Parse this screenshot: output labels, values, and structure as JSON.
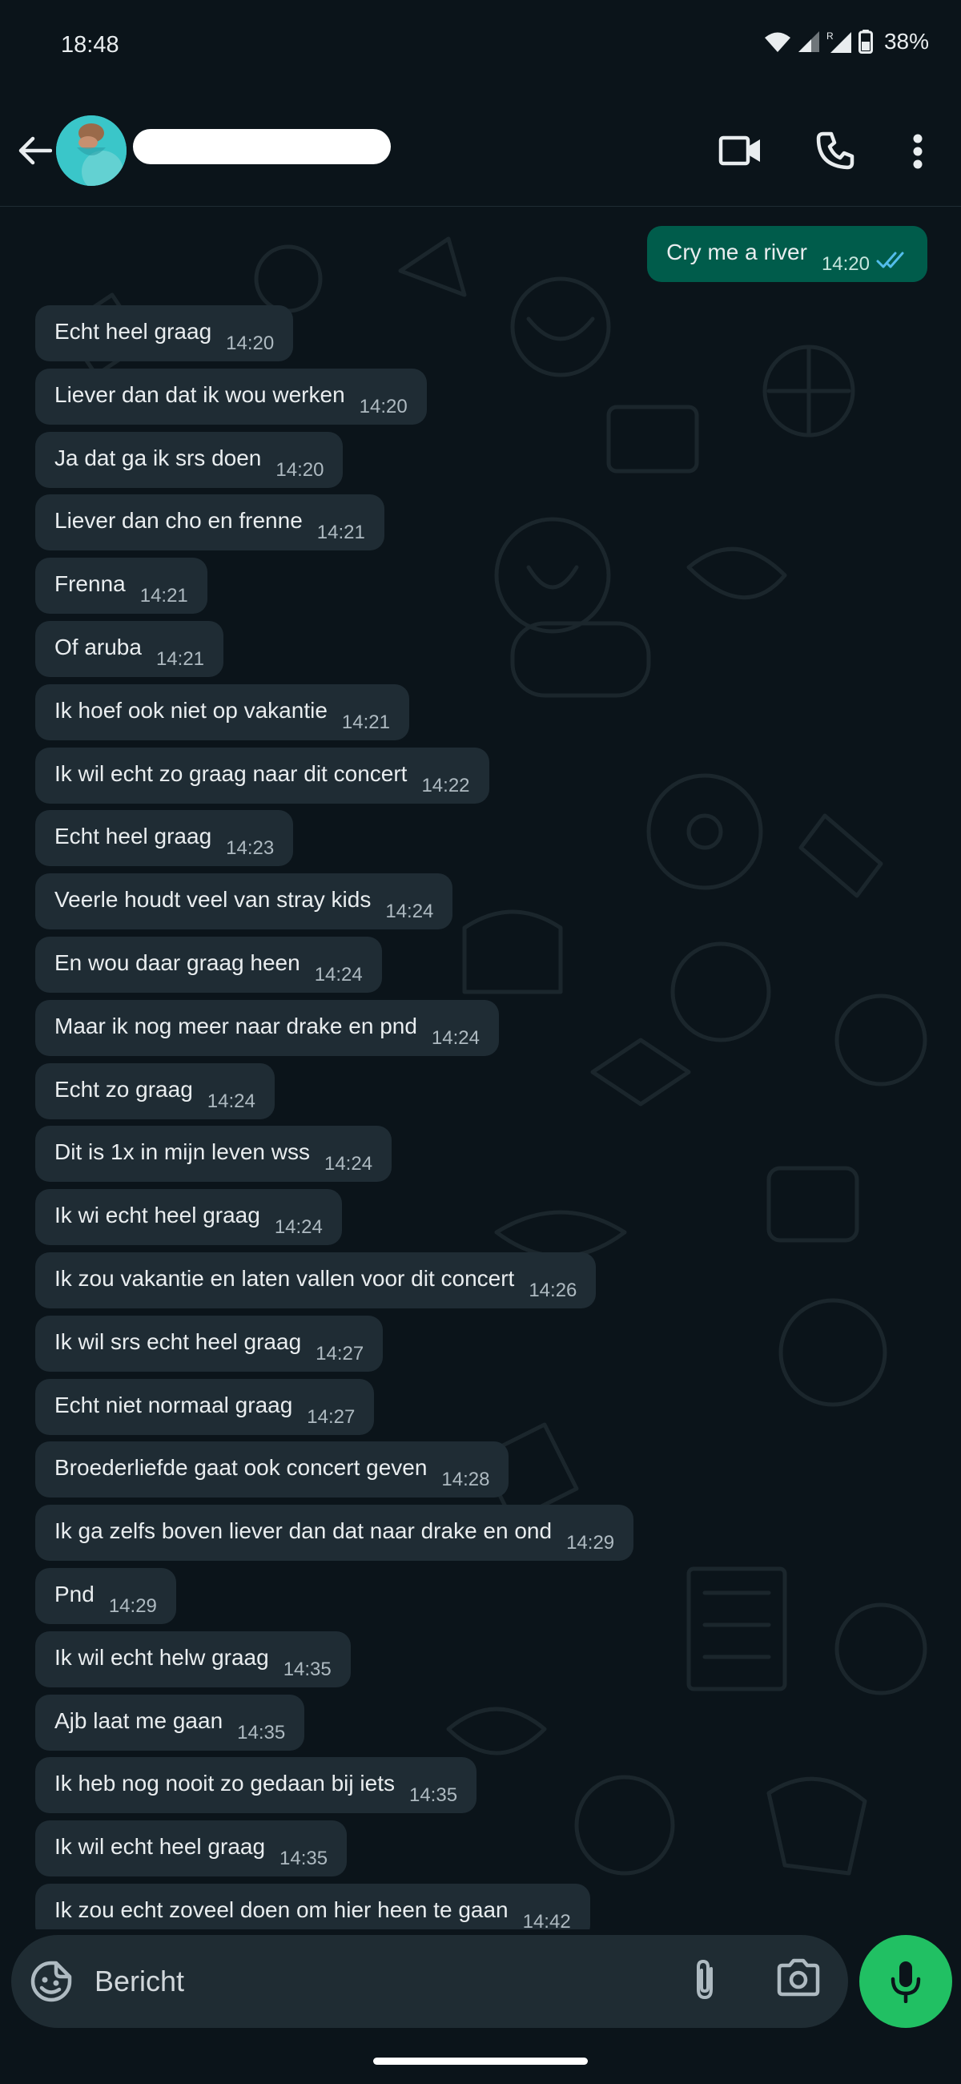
{
  "status_bar": {
    "time": "18:48",
    "battery_text": "38%",
    "icons": [
      "wifi-icon",
      "signal-icon",
      "signal-roaming-icon",
      "battery-icon"
    ]
  },
  "header": {
    "contact_name": "",
    "icons": [
      "back-arrow-icon",
      "avatar",
      "video-call-icon",
      "phone-icon",
      "more-vert-icon"
    ]
  },
  "outgoing_message": {
    "text": "Cry me a river",
    "time": "14:20",
    "status_icon": "double-check-read-icon",
    "status_color": "#53bdeb"
  },
  "messages": [
    {
      "text": "Echt heel graag",
      "time": "14:20"
    },
    {
      "text": "Liever dan dat ik wou werken",
      "time": "14:20"
    },
    {
      "text": "Ja dat ga ik srs doen",
      "time": "14:20"
    },
    {
      "text": "Liever dan cho en frenne",
      "time": "14:21"
    },
    {
      "text": "Frenna",
      "time": "14:21"
    },
    {
      "text": "Of aruba",
      "time": "14:21"
    },
    {
      "text": "Ik hoef ook niet op vakantie",
      "time": "14:21"
    },
    {
      "text": "Ik wil echt zo graag naar dit concert",
      "time": "14:22"
    },
    {
      "text": "Echt heel graag",
      "time": "14:23"
    },
    {
      "text": "Veerle houdt veel van stray kids",
      "time": "14:24"
    },
    {
      "text": "En wou daar graag heen",
      "time": "14:24"
    },
    {
      "text": "Maar ik nog meer naar drake en pnd",
      "time": "14:24"
    },
    {
      "text": "Echt zo graag",
      "time": "14:24"
    },
    {
      "text": "Dit is 1x in mijn leven wss",
      "time": "14:24"
    },
    {
      "text": "Ik wi echt heel graag",
      "time": "14:24"
    },
    {
      "text": "Ik zou vakantie en laten vallen voor dit concert",
      "time": "14:26"
    },
    {
      "text": "Ik wil srs echt heel graag",
      "time": "14:27"
    },
    {
      "text": "Echt niet normaal graag",
      "time": "14:27"
    },
    {
      "text": "Broederliefde gaat ook concert geven",
      "time": "14:28"
    },
    {
      "text": "Ik ga zelfs boven liever dan dat naar drake en ond",
      "time": "14:29"
    },
    {
      "text": "Pnd",
      "time": "14:29"
    },
    {
      "text": "Ik wil echt helw graag",
      "time": "14:35"
    },
    {
      "text": "Ajb laat me gaan",
      "time": "14:35"
    },
    {
      "text": "Ik heb nog nooit zo gedaan bij iets",
      "time": "14:35"
    },
    {
      "text": "Ik wil echt heel graag",
      "time": "14:35"
    },
    {
      "text": "Ik zou echt zoveel doen om hier heen te gaan",
      "time": "14:42"
    }
  ],
  "input_bar": {
    "placeholder": "Bericht",
    "icons": [
      "emoji-icon",
      "paperclip-icon",
      "camera-icon",
      "microphone-icon"
    ]
  },
  "scroll_button_icon": "double-chevron-down-icon",
  "colors": {
    "background": "#0b141a",
    "incoming_bubble": "#1f2c34",
    "outgoing_bubble": "#005c4b",
    "mic_button": "#21c063"
  }
}
